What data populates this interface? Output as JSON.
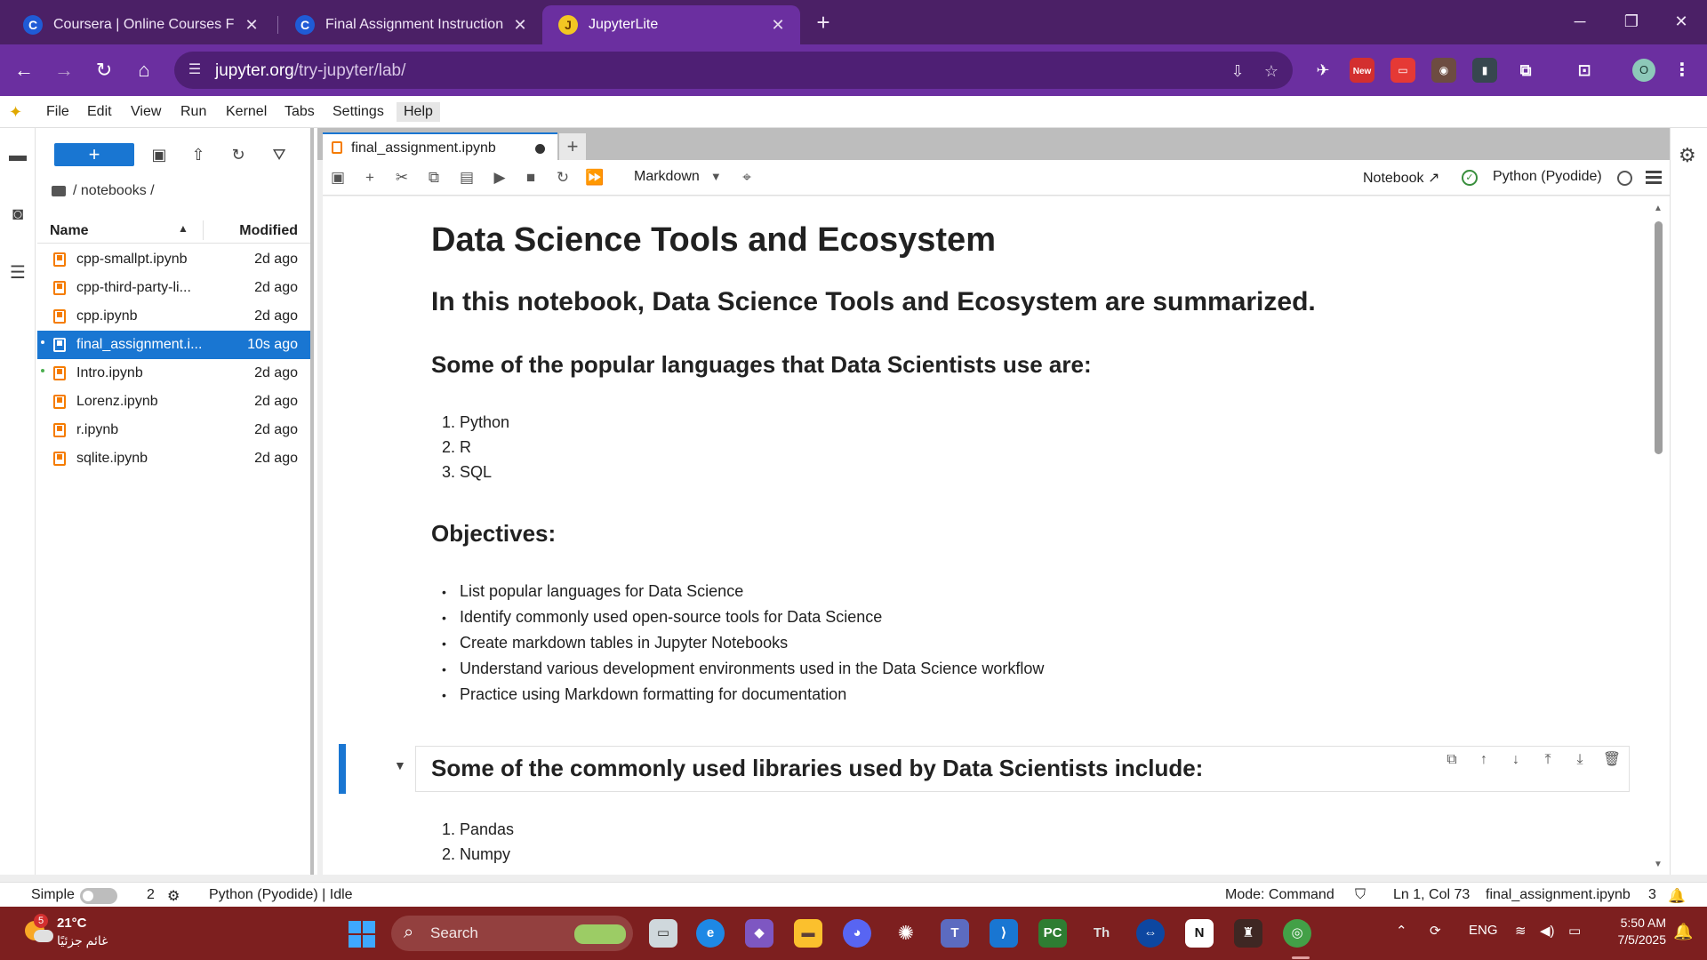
{
  "browser": {
    "tabs": [
      {
        "title": "Coursera | Online Courses From",
        "favicon": "C"
      },
      {
        "title": "Final Assignment Instructions: C",
        "favicon": "C"
      },
      {
        "title": "JupyterLite",
        "favicon": "J",
        "active": true
      }
    ],
    "url_domain": "jupyter.org",
    "url_path": "/try-jupyter/lab/",
    "extension_new_badge": "New",
    "profile_initial": "O"
  },
  "menubar": {
    "items": [
      "File",
      "Edit",
      "View",
      "Run",
      "Kernel",
      "Tabs",
      "Settings",
      "Help"
    ],
    "open_item": "Help"
  },
  "filebrowser": {
    "breadcrumb": "/ notebooks /",
    "header_name": "Name",
    "header_modified": "Modified",
    "files": [
      {
        "name": "cpp-smallpt.ipynb",
        "modified": "2d ago",
        "running": false,
        "selected": false
      },
      {
        "name": "cpp-third-party-li...",
        "modified": "2d ago",
        "running": false,
        "selected": false
      },
      {
        "name": "cpp.ipynb",
        "modified": "2d ago",
        "running": false,
        "selected": false
      },
      {
        "name": "final_assignment.i...",
        "modified": "10s ago",
        "running": true,
        "selected": true
      },
      {
        "name": "Intro.ipynb",
        "modified": "2d ago",
        "running": true,
        "selected": false
      },
      {
        "name": "Lorenz.ipynb",
        "modified": "2d ago",
        "running": false,
        "selected": false
      },
      {
        "name": "r.ipynb",
        "modified": "2d ago",
        "running": false,
        "selected": false
      },
      {
        "name": "sqlite.ipynb",
        "modified": "2d ago",
        "running": false,
        "selected": false
      }
    ]
  },
  "notebook": {
    "tab_title": "final_assignment.ipynb",
    "cell_type": "Markdown",
    "notebook_link": "Notebook",
    "kernel_name": "Python (Pyodide)",
    "title": "Data Science Tools and Ecosystem",
    "intro": "In this notebook, Data Science Tools and Ecosystem are summarized.",
    "languages_heading": "Some of the popular languages that Data Scientists use are:",
    "languages": [
      "Python",
      "R",
      "SQL"
    ],
    "objectives_heading": "Objectives:",
    "objectives": [
      "List popular languages for Data Science",
      "Identify commonly used open-source tools for Data Science",
      "Create markdown tables in Jupyter Notebooks",
      "Understand various development environments used in the Data Science workflow",
      "Practice using Markdown formatting for documentation"
    ],
    "libraries_heading": "Some of the commonly used libraries used by Data Scientists include:",
    "libraries": [
      "Pandas",
      "Numpy"
    ]
  },
  "statusbar": {
    "mode_label": "Simple",
    "kernel_count": "2",
    "kernel_status": "Python (Pyodide) | Idle",
    "mode": "Mode: Command",
    "cursor": "Ln 1, Col 73",
    "filename": "final_assignment.ipynb",
    "notifications": "3"
  },
  "taskbar": {
    "temperature": "21°C",
    "condition": "غائم جزئيًا",
    "weather_badge": "5",
    "search_label": "Search",
    "language": "ENG",
    "time": "5:50 AM",
    "date": "7/5/2025"
  },
  "colors": {
    "browser_frame": "#4b2066",
    "browser_toolbar": "#6b2fa0",
    "jupyter_accent": "#1976d2",
    "notebook_icon": "#f57c00",
    "taskbar": "#7d1f1f"
  }
}
